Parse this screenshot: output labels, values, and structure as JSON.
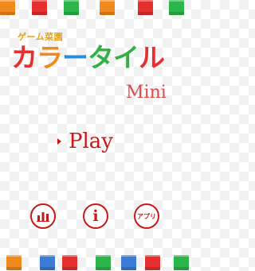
{
  "top_tiles": [
    "#f08a1c",
    "#e53030",
    "#2cb54a",
    "#f08a1c",
    "#e53030",
    "#2cb54a"
  ],
  "bottom_tiles": [
    "#f08a1c",
    "#3c7bd6",
    "#e53030",
    "#2cb54a",
    "#3c7bd6",
    "#e53030",
    "#2cb54a"
  ],
  "brand": "ゲーム菜園",
  "title": {
    "chars": [
      {
        "char": "カ",
        "color": "#e53030"
      },
      {
        "char": "ラ",
        "color": "#f08a1c"
      },
      {
        "char": "ー",
        "color": "#2a8de0"
      },
      {
        "char": "タ",
        "color": "#35b044"
      },
      {
        "char": "イ",
        "color": "#35b044"
      },
      {
        "char": "ル",
        "color": "#e53030"
      }
    ]
  },
  "subtitle": "Mini",
  "play_label": "Play",
  "buttons": {
    "app_label": "アプリ"
  },
  "icons": {
    "ranking": "bar-chart-icon",
    "info": "info-icon",
    "play": "play-arrow-icon"
  }
}
